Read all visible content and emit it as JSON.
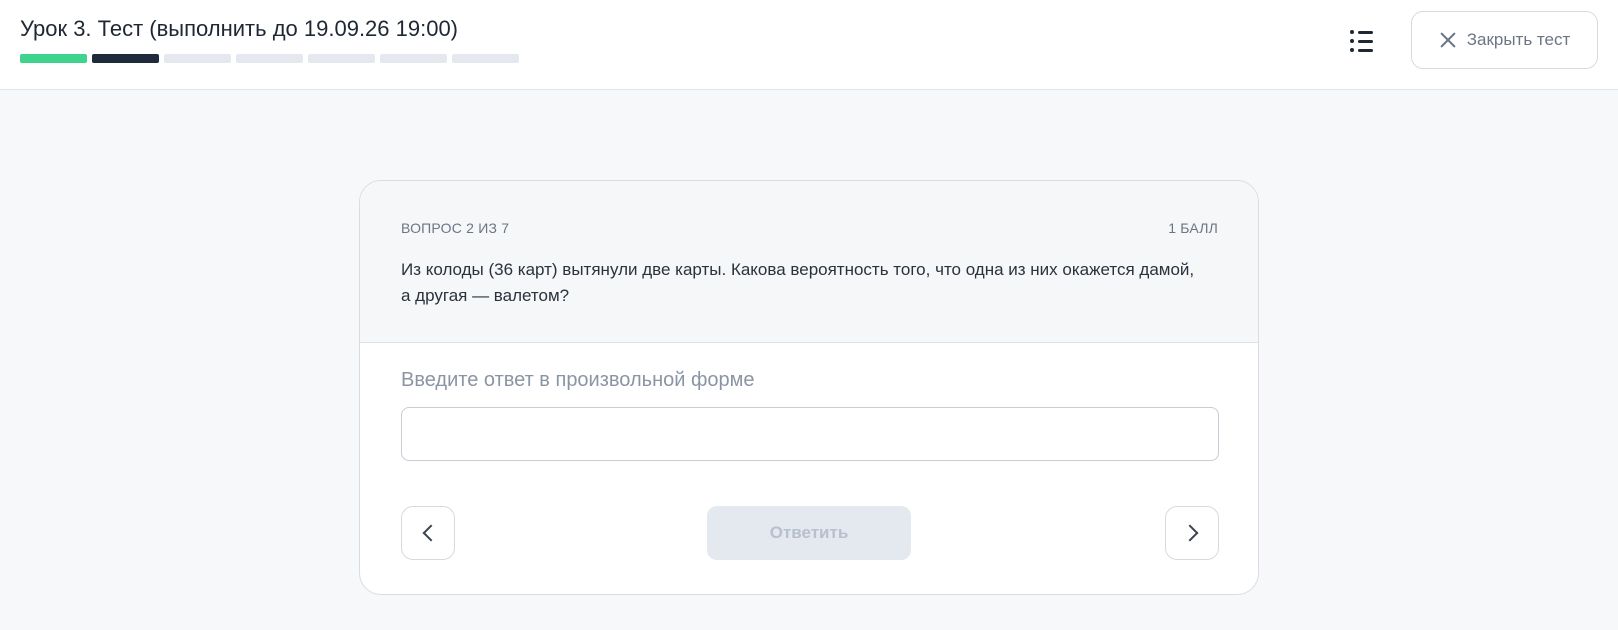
{
  "header": {
    "title": "Урок 3. Тест (выполнить до 19.09.26 19:00)",
    "progress": [
      "done",
      "current",
      "pending",
      "pending",
      "pending",
      "pending",
      "pending"
    ],
    "menu_icon": "list-icon",
    "close_label": "Закрыть тест",
    "close_icon": "close-icon"
  },
  "question": {
    "counter": "ВОПРОС 2 ИЗ 7",
    "points": "1 БАЛЛ",
    "text": "Из колоды (36 карт) вытянули две карты. Какова вероятность того, что одна из них окажется дамой, а другая — валетом?"
  },
  "answer": {
    "label": "Введите ответ в произвольной форме",
    "value": "",
    "placeholder": ""
  },
  "controls": {
    "prev_icon": "chevron-left-icon",
    "next_icon": "chevron-right-icon",
    "submit_label": "Ответить"
  },
  "colors": {
    "progress_done": "#3ed48e",
    "progress_current": "#1f2a3a",
    "progress_pending": "#e5e8ee",
    "submit_disabled_bg": "#e4e8ef",
    "submit_disabled_text": "#b7c0cc"
  }
}
